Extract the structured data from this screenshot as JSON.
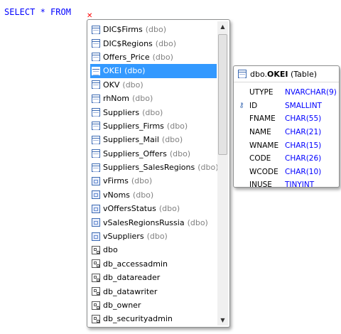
{
  "editor": {
    "text": "SELECT * FROM"
  },
  "autocomplete": {
    "items": [
      {
        "name": "DIC$Firms",
        "schema": "(dbo)",
        "icon": "table-icon"
      },
      {
        "name": "DIC$Regions",
        "schema": "(dbo)",
        "icon": "table-icon"
      },
      {
        "name": "Offers_Price",
        "schema": "(dbo)",
        "icon": "table-icon"
      },
      {
        "name": "OKEI",
        "schema": "(dbo)",
        "icon": "table-icon"
      },
      {
        "name": "OKV",
        "schema": "(dbo)",
        "icon": "table-icon"
      },
      {
        "name": "rhNom",
        "schema": "(dbo)",
        "icon": "table-icon"
      },
      {
        "name": "Suppliers",
        "schema": "(dbo)",
        "icon": "table-icon"
      },
      {
        "name": "Suppliers_Firms",
        "schema": "(dbo)",
        "icon": "table-icon"
      },
      {
        "name": "Suppliers_Mail",
        "schema": "(dbo)",
        "icon": "table-icon"
      },
      {
        "name": "Suppliers_Offers",
        "schema": "(dbo)",
        "icon": "table-icon"
      },
      {
        "name": "Suppliers_SalesRegions",
        "schema": "(dbo)",
        "icon": "table-icon"
      },
      {
        "name": "vFirms",
        "schema": "(dbo)",
        "icon": "view-icon"
      },
      {
        "name": "vNoms",
        "schema": "(dbo)",
        "icon": "view-icon"
      },
      {
        "name": "vOffersStatus",
        "schema": "(dbo)",
        "icon": "view-icon"
      },
      {
        "name": "vSalesRegionsRussia",
        "schema": "(dbo)",
        "icon": "view-icon"
      },
      {
        "name": "vSuppliers",
        "schema": "(dbo)",
        "icon": "view-icon"
      },
      {
        "name": "dbo",
        "schema": "",
        "icon": "schema-icon"
      },
      {
        "name": "db_accessadmin",
        "schema": "",
        "icon": "schema-icon"
      },
      {
        "name": "db_datareader",
        "schema": "",
        "icon": "schema-icon"
      },
      {
        "name": "db_datawriter",
        "schema": "",
        "icon": "schema-icon"
      },
      {
        "name": "db_owner",
        "schema": "",
        "icon": "schema-icon"
      },
      {
        "name": "db_securityadmin",
        "schema": "",
        "icon": "schema-icon"
      }
    ],
    "selected_index": 3
  },
  "tooltip": {
    "prefix": "dbo.",
    "name": "OKEI",
    "kind": "(Table)",
    "columns": [
      {
        "name": "UTYPE",
        "type": "NVARCHAR(9)",
        "key": false
      },
      {
        "name": "ID",
        "type": "SMALLINT",
        "key": true
      },
      {
        "name": "FNAME",
        "type": "CHAR(55)",
        "key": false
      },
      {
        "name": "NAME",
        "type": "CHAR(21)",
        "key": false
      },
      {
        "name": "WNAME",
        "type": "CHAR(15)",
        "key": false
      },
      {
        "name": "CODE",
        "type": "CHAR(26)",
        "key": false
      },
      {
        "name": "WCODE",
        "type": "CHAR(10)",
        "key": false
      },
      {
        "name": "INUSE",
        "type": "TINYINT",
        "key": false
      }
    ]
  },
  "colors": {
    "keyword": "#0000ff",
    "selection": "#3399ff",
    "schema_text": "#808080",
    "error_mark": "#ff0000"
  }
}
